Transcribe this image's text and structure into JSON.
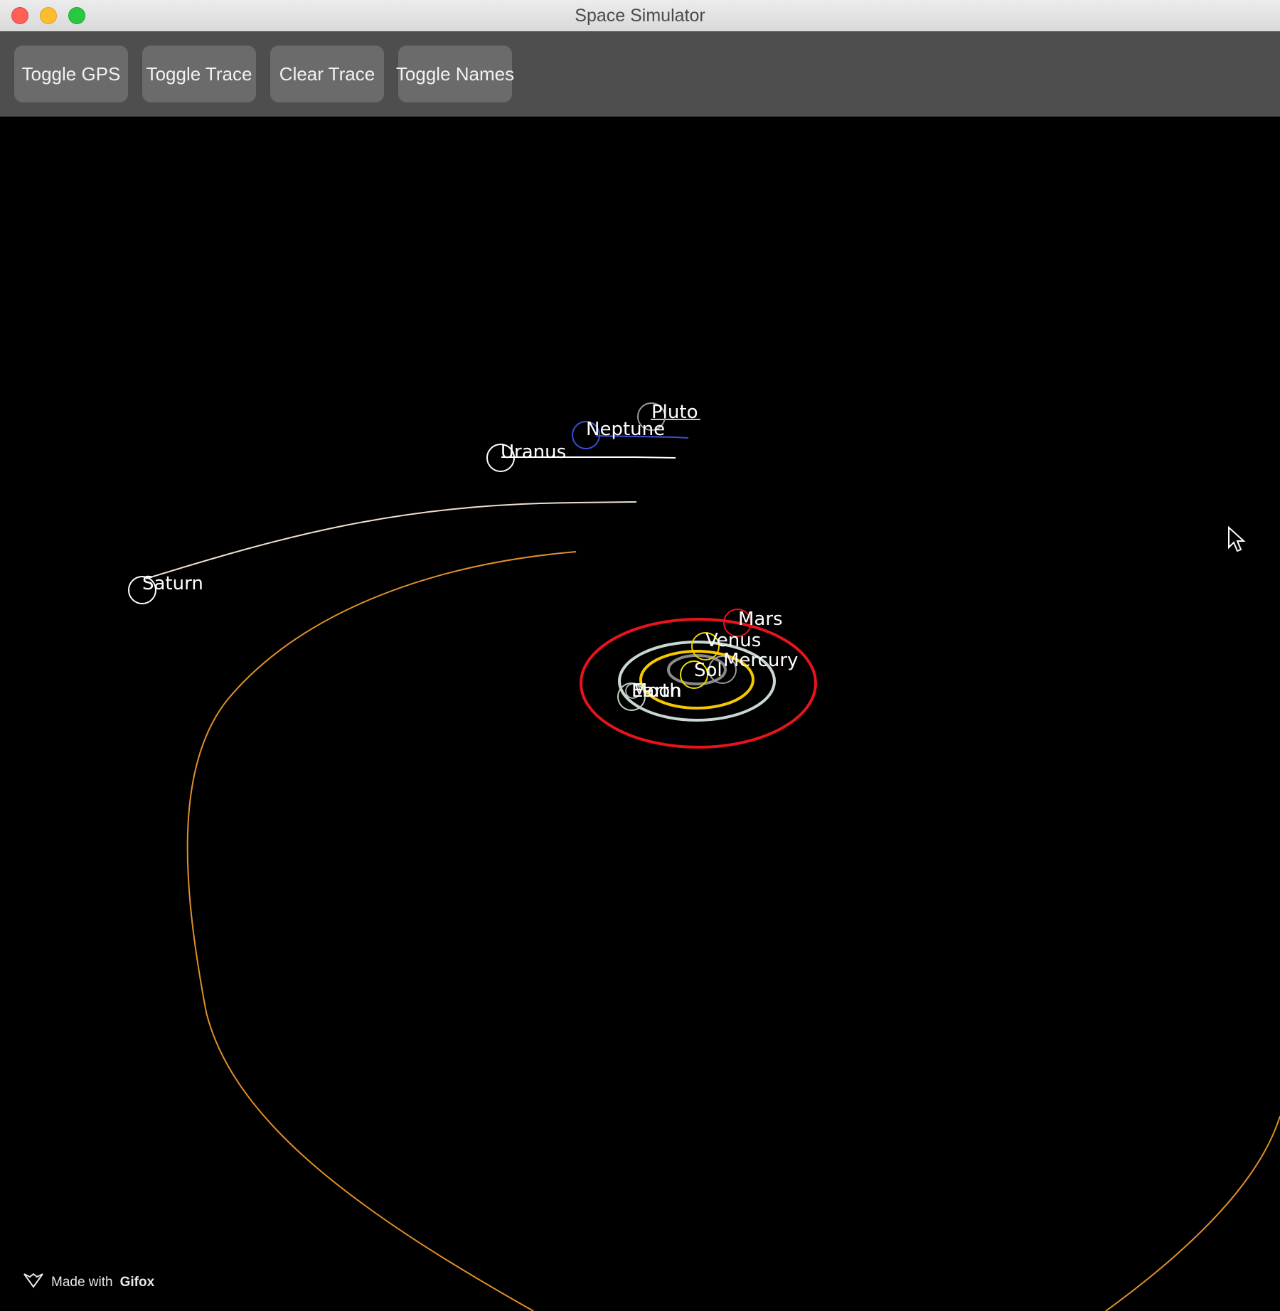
{
  "window": {
    "title": "Space Simulator"
  },
  "toolbar": {
    "buttons": [
      {
        "label": "Toggle GPS"
      },
      {
        "label": "Toggle Trace"
      },
      {
        "label": "Clear Trace"
      },
      {
        "label": "Toggle Names"
      }
    ]
  },
  "bodies": [
    {
      "name": "Pluto",
      "color": "#9a9a9a"
    },
    {
      "name": "Neptune",
      "color": "#3b4fd8"
    },
    {
      "name": "Uranus",
      "color": "#ffffff"
    },
    {
      "name": "Saturn",
      "color": "#ffffff"
    },
    {
      "name": "Mars",
      "color": "#e8141c"
    },
    {
      "name": "Venus",
      "color": "#f0d000"
    },
    {
      "name": "Mercury",
      "color": "#9a9a9a"
    },
    {
      "name": "Sol",
      "color": "#f0e000"
    },
    {
      "name": "Earth",
      "color": "#b8d8b8"
    },
    {
      "name": "Moon",
      "color": "#cccccc"
    }
  ],
  "traces": {
    "jupiter_color": "#e0902a",
    "saturn_color": "#f0e0d0",
    "uranus_color": "#ffffff",
    "neptune_color": "#3b4fd8",
    "mars_color": "#e8141c",
    "earth_color": "#c8d8d0",
    "venus_color": "#f5c800",
    "mercury_color": "#8a8a8a"
  },
  "watermark": {
    "prefix": "Made with",
    "brand": "Gifox"
  }
}
